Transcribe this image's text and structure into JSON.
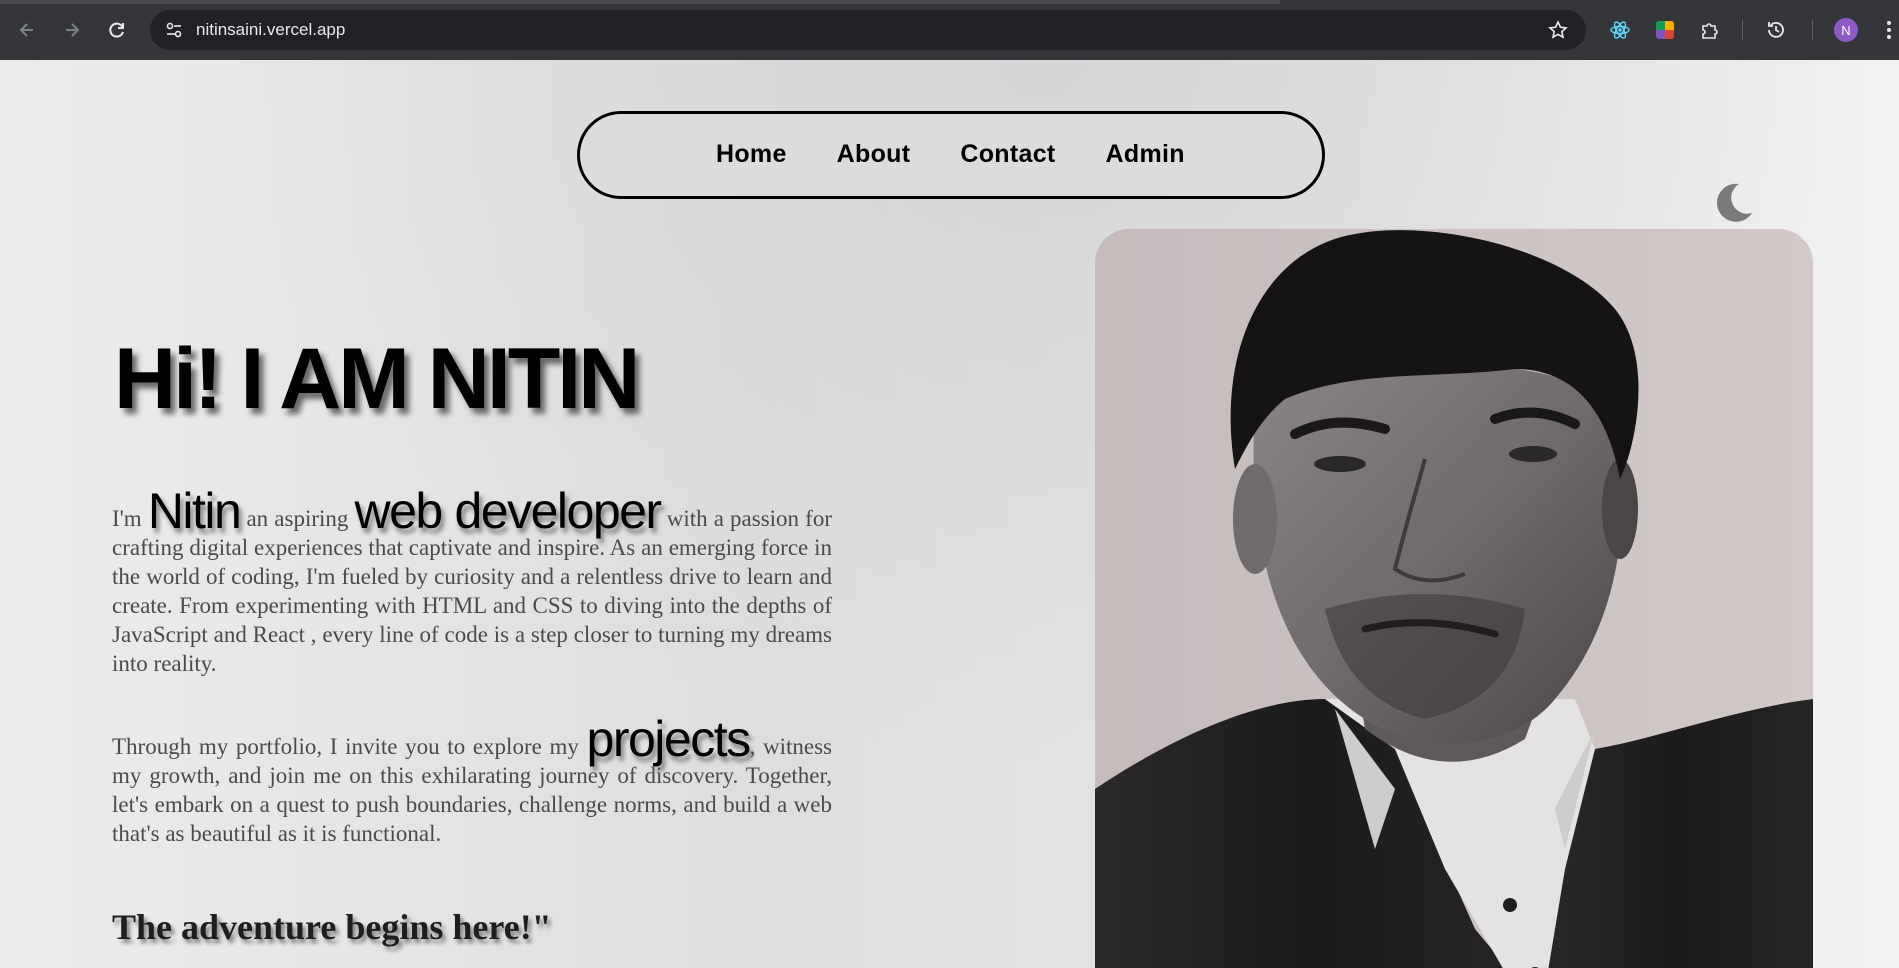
{
  "browser": {
    "url": "nitinsaini.vercel.app",
    "profile_initial": "N",
    "icons": {
      "back": "arrow-left-icon",
      "forward": "arrow-right-icon",
      "reload": "reload-icon",
      "site_info": "tune-icon",
      "bookmark": "star-icon",
      "ext1": "react-devtools-icon",
      "ext2": "color-picker-icon",
      "extensions": "puzzle-icon",
      "history": "history-icon",
      "menu": "kebab-icon"
    }
  },
  "nav": {
    "items": [
      {
        "label": "Home"
      },
      {
        "label": "About"
      },
      {
        "label": "Contact"
      },
      {
        "label": "Admin"
      }
    ]
  },
  "theme_toggle": {
    "icon": "moon-icon"
  },
  "hero": {
    "title": "Hi! I AM NITIN",
    "p1": {
      "t1": "I'm ",
      "name": "Nitin",
      "t2": " an aspiring ",
      "role": "web developer",
      "t3": " with a passion for crafting digital experiences that captivate and inspire. As an emerging force in the world of coding, I'm fueled by curiosity and a relentless drive to learn and create. From experimenting with HTML and CSS to diving into the depths of JavaScript and React , every line of code is a step closer to turning my dreams into reality."
    },
    "p2": {
      "t1": "Through my portfolio, I invite you to explore my ",
      "projects": "projects",
      "t2": ", witness my growth, and join me on this exhilarating journey of discovery. Together, let's embark on a quest to push boundaries, challenge norms, and build a web that's as beautiful as it is functional."
    },
    "quote": "The adventure begins here!\""
  },
  "colors": {
    "chrome_bg": "#35363a",
    "omnibox_bg": "#202124",
    "page_bg": "#e4e4e4",
    "avatar": "#8e5ac8",
    "moon": "#7a7a7a"
  }
}
